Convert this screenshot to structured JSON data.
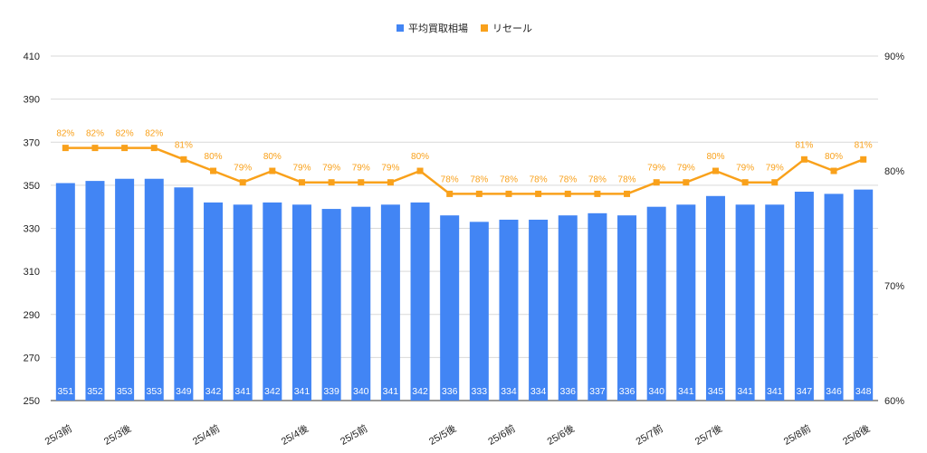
{
  "chart_data": {
    "type": "bar",
    "legend": {
      "position": "top",
      "items": [
        {
          "name": "平均買取相場",
          "color": "#4285F4",
          "marker": "square"
        },
        {
          "name": "リセール",
          "color": "#F9A11B",
          "marker": "square"
        }
      ]
    },
    "left_axis": {
      "min": 250,
      "max": 410,
      "ticks": [
        "250",
        "270",
        "290",
        "310",
        "330",
        "350",
        "370",
        "390",
        "410"
      ]
    },
    "right_axis": {
      "min": 0.6,
      "max": 0.9,
      "ticks": [
        "60%",
        "70%",
        "80%",
        "90%"
      ]
    },
    "grid": true,
    "x_tick_labels": [
      "25/3前",
      "",
      "25/3後",
      "",
      "",
      "25/4前",
      "",
      "",
      "25/4後",
      "",
      "25/5前",
      "",
      "",
      "25/5後",
      "",
      "25/6前",
      "",
      "25/6後",
      "",
      "",
      "25/7前",
      "",
      "25/7後",
      "",
      "",
      "25/8前",
      "",
      "25/8後"
    ],
    "series": [
      {
        "name": "平均買取相場",
        "type": "bar",
        "color": "#4285F4",
        "axis": "left",
        "values": [
          351,
          352,
          353,
          353,
          349,
          342,
          341,
          342,
          341,
          339,
          340,
          341,
          342,
          336,
          333,
          334,
          334,
          336,
          337,
          336,
          340,
          341,
          345,
          341,
          341,
          347,
          346,
          348
        ],
        "labels": [
          "351",
          "352",
          "353",
          "353",
          "349",
          "342",
          "341",
          "342",
          "341",
          "339",
          "340",
          "341",
          "342",
          "336",
          "333",
          "334",
          "334",
          "336",
          "337",
          "336",
          "340",
          "341",
          "345",
          "341",
          "341",
          "347",
          "346",
          "348"
        ]
      },
      {
        "name": "リセール",
        "type": "line",
        "color": "#F9A11B",
        "axis": "right",
        "values": [
          0.82,
          0.82,
          0.82,
          0.82,
          0.81,
          0.8,
          0.79,
          0.8,
          0.79,
          0.79,
          0.79,
          0.79,
          0.8,
          0.78,
          0.78,
          0.78,
          0.78,
          0.78,
          0.78,
          0.78,
          0.79,
          0.79,
          0.8,
          0.79,
          0.79,
          0.81,
          0.8,
          0.81
        ],
        "labels": [
          "82%",
          "82%",
          "82%",
          "82%",
          "81%",
          "80%",
          "79%",
          "80%",
          "79%",
          "79%",
          "79%",
          "79%",
          "80%",
          "78%",
          "78%",
          "78%",
          "78%",
          "78%",
          "78%",
          "78%",
          "79%",
          "79%",
          "80%",
          "79%",
          "79%",
          "81%",
          "80%",
          "81%"
        ]
      }
    ]
  }
}
